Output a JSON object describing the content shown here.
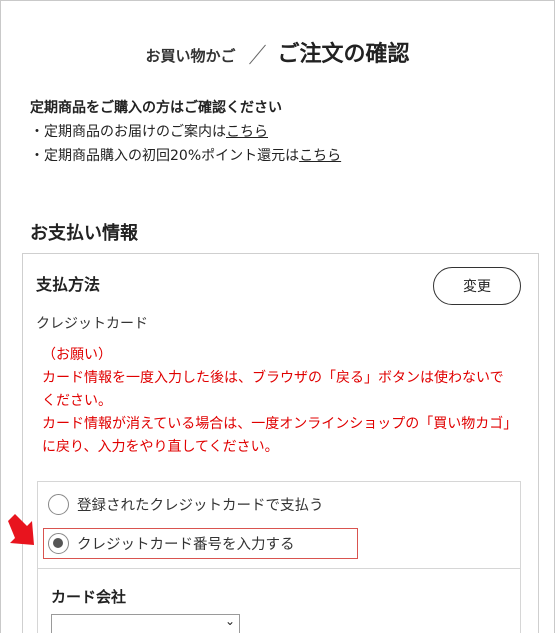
{
  "header": {
    "breadcrumb": "お買い物かご",
    "title": "ご注文の確認"
  },
  "notice": {
    "heading": "定期商品をご購入の方はご確認ください",
    "line1_text": "・定期商品のお届けのご案内は",
    "line1_link": "こちら",
    "line2_text": "・定期商品購入の初回20%ポイント還元は",
    "line2_link": "こちら"
  },
  "payment": {
    "section_title": "お支払い情報",
    "method_label": "支払方法",
    "change_button": "変更",
    "method_value": "クレジットカード",
    "warning": [
      "（お願い）",
      "カード情報を一度入力した後は、ブラウザの「戻る」ボタンは使わないでください。",
      "カード情報が消えている場合は、一度オンラインショップの「買い物カゴ」に戻り、入力をやり直してください。"
    ],
    "options": [
      {
        "label": "登録されたクレジットカードで支払う",
        "selected": false
      },
      {
        "label": "クレジットカード番号を入力する",
        "selected": true
      }
    ],
    "card_company_label": "カード会社",
    "card_company_value": ""
  },
  "colors": {
    "warning_text": "#e00000",
    "highlight_border": "#d9534f",
    "pointer_arrow": "#e8141e"
  },
  "icons": {
    "pointer": "red-arrow-icon",
    "dropdown": "chevron-down-icon"
  }
}
